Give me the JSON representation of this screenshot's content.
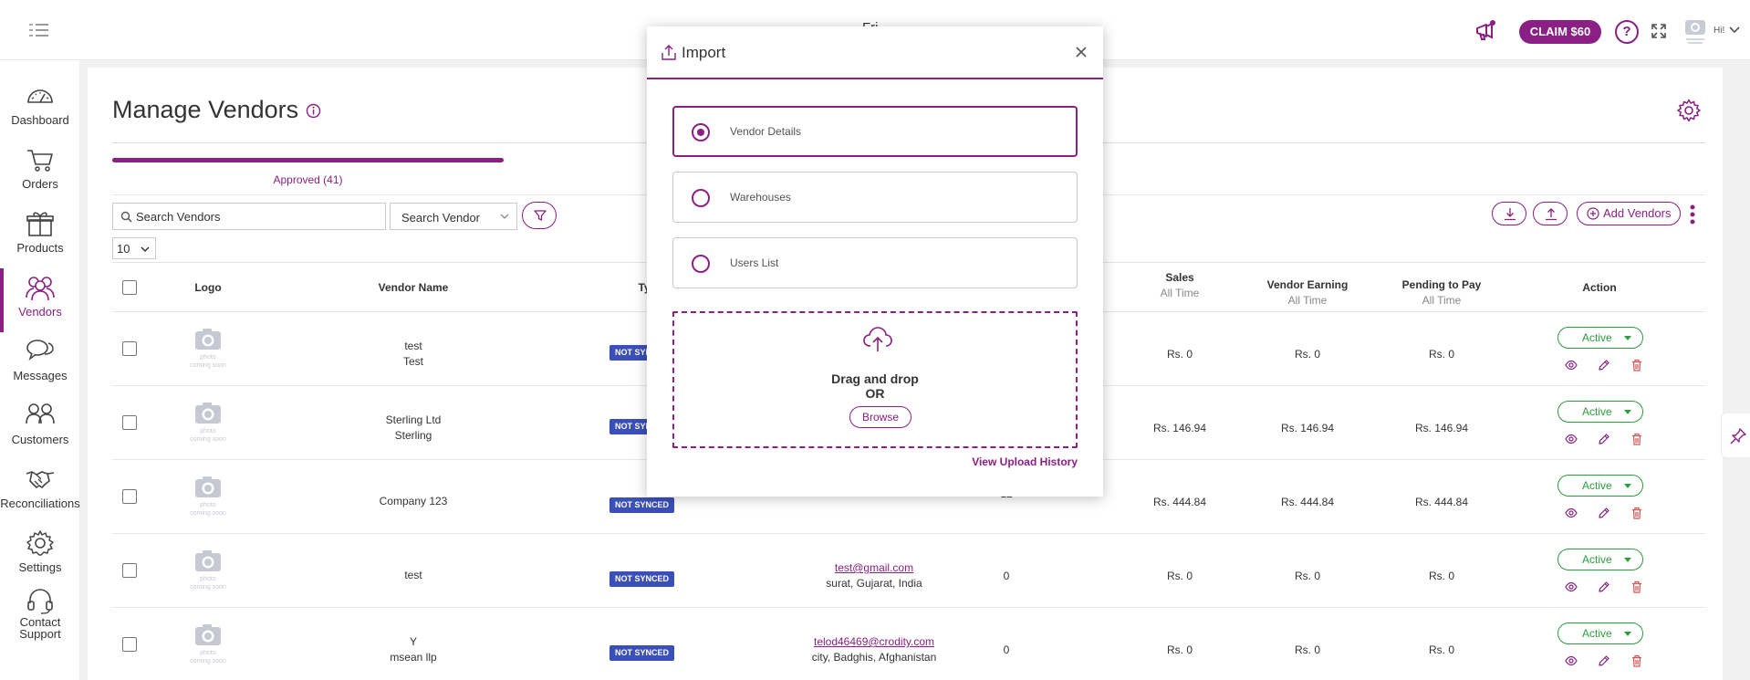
{
  "topbar": {
    "title": "Fri",
    "claim_label": "CLAIM $60",
    "help_label": "?",
    "greeting": "Hi!"
  },
  "sidebar": {
    "items": [
      {
        "label": "Dashboard",
        "icon": "dashboard-icon"
      },
      {
        "label": "Orders",
        "icon": "cart-icon"
      },
      {
        "label": "Products",
        "icon": "gift-icon"
      },
      {
        "label": "Vendors",
        "icon": "users-icon",
        "active": true
      },
      {
        "label": "Messages",
        "icon": "chat-icon"
      },
      {
        "label": "Customers",
        "icon": "customers-icon"
      },
      {
        "label": "Reconciliations",
        "icon": "handshake-icon"
      },
      {
        "label": "Settings",
        "icon": "gear-icon"
      },
      {
        "label": "Contact Support",
        "icon": "headset-icon"
      }
    ]
  },
  "page": {
    "title": "Manage Vendors",
    "tab_label": "Approved (41)",
    "search_placeholder": "Search Vendors",
    "search_value": "Search Vendors",
    "search_by": "Search Vendor",
    "page_size": "10",
    "add_vendors_label": "Add Vendors"
  },
  "table": {
    "headers": {
      "logo": "Logo",
      "vendor_name": "Vendor Name",
      "type": "Type",
      "sales": "Sales",
      "sales_sub": "All Time",
      "vendor_earning": "Vendor Earning",
      "vendor_earning_sub": "All Time",
      "pending": "Pending to Pay",
      "pending_sub": "All Time",
      "action": "Action"
    },
    "logo_text": "photo coming soon",
    "rows": [
      {
        "name1": "test",
        "name2": "Test",
        "badge": "NOT SYNCED",
        "email": "",
        "location": "",
        "count": "",
        "sales": "Rs. 0",
        "earning": "Rs. 0",
        "pending": "Rs. 0",
        "status": "Active"
      },
      {
        "name1": "Sterling Ltd",
        "name2": "Sterling",
        "badge": "NOT SYNCED",
        "email": "",
        "location": "",
        "count": "",
        "sales": "Rs. 146.94",
        "earning": "Rs. 146.94",
        "pending": "Rs. 146.94",
        "status": "Active"
      },
      {
        "name1": "Company 123",
        "name2": "",
        "badge": "NOT SYNCED",
        "email": "",
        "location": "",
        "count": "12",
        "sales": "Rs. 444.84",
        "earning": "Rs. 444.84",
        "pending": "Rs. 444.84",
        "status": "Active"
      },
      {
        "name1": "test",
        "name2": "",
        "badge": "NOT SYNCED",
        "email": "test@gmail.com",
        "location": "surat, Gujarat, India",
        "count": "0",
        "sales": "Rs. 0",
        "earning": "Rs. 0",
        "pending": "Rs. 0",
        "status": "Active"
      },
      {
        "name1": "Y",
        "name2": "msean llp",
        "badge": "NOT SYNCED",
        "email": "telod46469@crodity.com",
        "location": "city, Badghis, Afghanistan",
        "count": "0",
        "sales": "Rs. 0",
        "earning": "Rs. 0",
        "pending": "Rs. 0",
        "status": "Active"
      }
    ]
  },
  "modal": {
    "title": "Import",
    "options": [
      {
        "label": "Vendor Details",
        "selected": true
      },
      {
        "label": "Warehouses",
        "selected": false
      },
      {
        "label": "Users List",
        "selected": false
      }
    ],
    "drag_text": "Drag and drop",
    "or_text": "OR",
    "browse_label": "Browse",
    "history_label": "View Upload History"
  },
  "colors": {
    "accent": "#8a1f84",
    "active_green": "#2e9b3d",
    "badge_blue": "#3b4fb8",
    "delete_red": "#d9534f"
  }
}
